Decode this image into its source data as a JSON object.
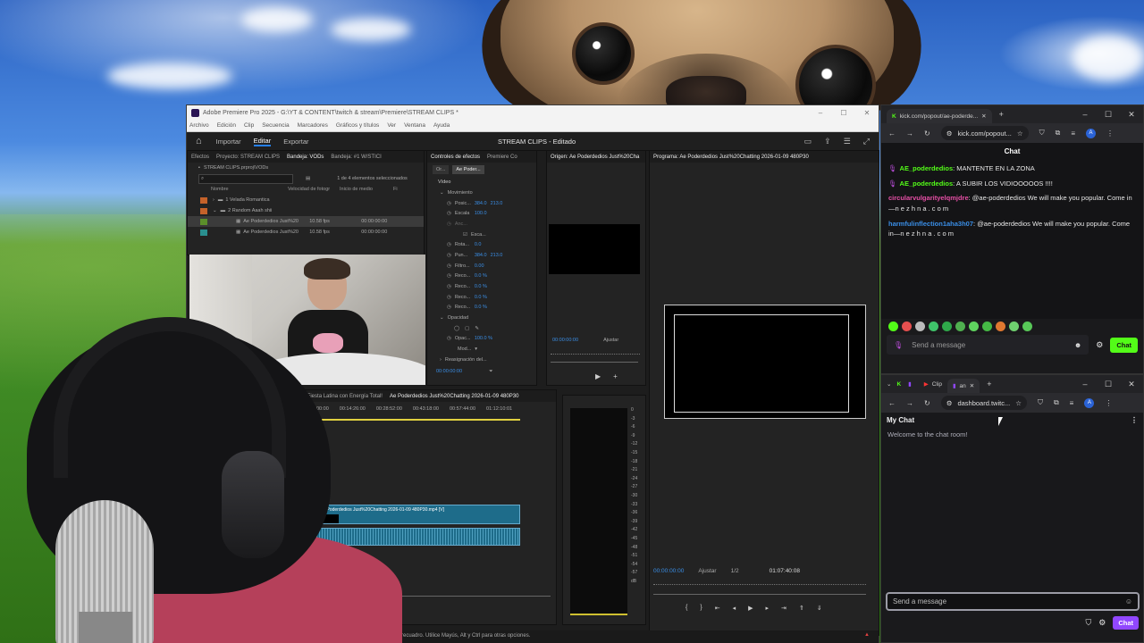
{
  "premiere": {
    "window_title": "Adobe Premiere Pro 2025 - G:\\YT & CONTENT\\twitch & stream\\Premiere\\STREAM CLIPS *",
    "menu": [
      "Archivo",
      "Edición",
      "Clip",
      "Secuencia",
      "Marcadores",
      "Gráficos y títulos",
      "Ver",
      "Ventana",
      "Ayuda"
    ],
    "workspaces": [
      "Importar",
      "Editar",
      "Exportar"
    ],
    "project_title": "STREAM CLIPS - Editado",
    "project_panel": {
      "tabs": [
        "Efectos",
        "Proyecto: STREAM CLIPS",
        "Bandeja: VODs",
        "Bandeja: #1 W/STICI"
      ],
      "path": "STREAM CLIPS.prproj\\VODs",
      "selection": "1 de 4 elementos seleccionados",
      "columns": [
        "Nombre",
        "Velocidad de fotogr",
        "Inicio de medio",
        "Fi"
      ],
      "rows": [
        {
          "name": "1 Velada Romantica",
          "fps": "",
          "start": ""
        },
        {
          "name": "2 Random Aaah shii",
          "fps": "",
          "start": ""
        },
        {
          "name": "Ae Poderdedios Just%20",
          "fps": "10.58 fps",
          "start": "00:00:00:00"
        },
        {
          "name": "Ae Poderdedios Just%20",
          "fps": "10.58 fps",
          "start": "00:00:00:00"
        }
      ]
    },
    "effects_panel": {
      "tabs": [
        "Controles de efectos",
        "Premiere Co"
      ],
      "subtabs": [
        "Or...",
        "Ae Poder..."
      ],
      "header": "Vídeo",
      "rows": [
        {
          "label": "Movimiento",
          "val": "",
          "val2": ""
        },
        {
          "label": "Posic...",
          "val": "384.0",
          "val2": "213.0"
        },
        {
          "label": "Escala",
          "val": "100.0",
          "val2": ""
        },
        {
          "label": "Anc...",
          "val": "",
          "val2": ""
        },
        {
          "label": "Esca...",
          "val": "",
          "val2": ""
        },
        {
          "label": "Rota...",
          "val": "0.0",
          "val2": ""
        },
        {
          "label": "Pun...",
          "val": "384.0",
          "val2": "213.0"
        },
        {
          "label": "Filtro...",
          "val": "0.00",
          "val2": ""
        },
        {
          "label": "Reco...",
          "val": "0.0 %",
          "val2": ""
        },
        {
          "label": "Reco...",
          "val": "0.0 %",
          "val2": ""
        },
        {
          "label": "Reco...",
          "val": "0.0 %",
          "val2": ""
        },
        {
          "label": "Reco...",
          "val": "0.0 %",
          "val2": ""
        },
        {
          "label": "Opacidad",
          "val": "",
          "val2": ""
        },
        {
          "label": "",
          "val": "",
          "val2": ""
        },
        {
          "label": "Opac...",
          "val": "100.0 %",
          "val2": ""
        },
        {
          "label": "Mod...",
          "val": "",
          "val2": ""
        },
        {
          "label": "Reasignación del...",
          "val": "",
          "val2": ""
        }
      ],
      "timecode": "00:00:00:00"
    },
    "source_monitor": {
      "tab": "Origen: Ae Poderdedios Just%20Cha",
      "timecode": "00:00:00:00",
      "fit": "Ajustar"
    },
    "program_monitor": {
      "tab": "Programa: Ae Poderdedios Just%20Chatting 2026-01-09 480P30",
      "timecode": "00:00:00:00",
      "fit": "Ajustar",
      "quality": "1/2",
      "duration": "01:07:40:08"
    },
    "timeline": {
      "tabs": [
        "va España! ¡Fiesta Latina con Energía Total!",
        "Ae Poderdedios Just%20Chatting 2026-01-09 480P30"
      ],
      "ruler": [
        "00:00",
        "00:14:26:00",
        "00:28:52:00",
        "00:43:18:00",
        "00:57:44:00",
        "01:12:10:01"
      ],
      "clip_label": "Ae Poderdedios Just%20Chatting 2026-01-09 480P30.mp4 [V]"
    },
    "meter_scale": [
      "0",
      "-3",
      "-6",
      "-9",
      "-12",
      "-15",
      "-18",
      "-21",
      "-24",
      "-27",
      "-30",
      "-33",
      "-36",
      "-39",
      "-42",
      "-45",
      "-48",
      "-51",
      "-54",
      "-57",
      "dB"
    ],
    "status_bar": "recuadro. Utilice Mayús, Alt y Ctrl para otras opciones."
  },
  "kick": {
    "tab_title": "kick.com/popout/ae-poderde...",
    "address": "kick.com/popout...",
    "chat_header": "Chat",
    "messages": [
      {
        "user": "AE_poderdedios",
        "text": ": MANTENTE EN LA ZONA",
        "style": "green",
        "badge": true
      },
      {
        "user": "AE_poderdedios",
        "text": ": A SUBIR LOS VIDIOOOOOS !!!!",
        "style": "green",
        "badge": true
      },
      {
        "user": "circularvulgarityelqmjdre",
        "text": ": @ae-poderdedios We will make you popular. Come in—n e z h n a . c o m",
        "style": "pink",
        "badge": false
      },
      {
        "user": "harmfulinflection1aha3h07",
        "text": ": @ae-poderdedios We will make you popular. Come in—n e z h n a . c o m",
        "style": "blue",
        "badge": false
      }
    ],
    "emote_colors": [
      "#53fc18",
      "#e64f4f",
      "#bbbbbb",
      "#3fc26a",
      "#2fa84a",
      "#4fb04f",
      "#5fd35f",
      "#45b845",
      "#e07830",
      "#6fd06f",
      "#58c858"
    ],
    "input_placeholder": "Send a message",
    "chat_button": "Chat",
    "accent": "#53fc18"
  },
  "twitch": {
    "tabs": [
      "Clip",
      "an"
    ],
    "address": "dashboard.twitc...",
    "chat_header": "My Chat",
    "welcome": "Welcome to the chat room!",
    "input_placeholder": "Send a message",
    "chat_button": "Chat",
    "accent": "#9147ff"
  }
}
